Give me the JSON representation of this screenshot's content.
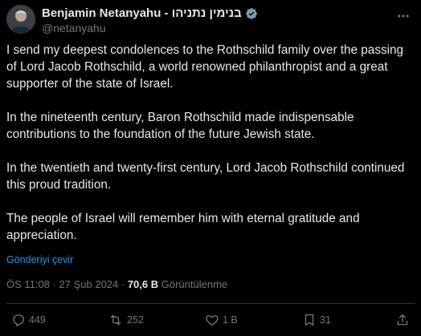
{
  "author": {
    "display_name": "Benjamin Netanyahu - בנימין נתניהו",
    "handle": "@netanyahu",
    "verified_color": "#829aab"
  },
  "tweet": {
    "paragraphs": [
      "I send my deepest condolences to the Rothschild family over the passing of Lord Jacob Rothschild, a world renowned philanthropist and a great supporter of the state of Israel.",
      "In the nineteenth century, Baron Rothschild made indispensable contributions to the foundation of the future Jewish state.",
      "In the twentieth and twenty-first century, Lord Jacob Rothschild continued this proud tradition.",
      "The people of Israel will remember him with eternal gratitude and appreciation."
    ],
    "translate_label": "Gönderiyi çevir"
  },
  "meta": {
    "time": "ÖS 11:08",
    "separator": " · ",
    "date": "27 Şub 2024",
    "views_count": "70,6 B",
    "views_label": " Görüntülenme"
  },
  "actions": {
    "replies": "449",
    "retweets": "252",
    "likes": "1 B",
    "bookmarks": "31"
  },
  "colors": {
    "background": "#000000",
    "text": "#e7e9ea",
    "muted": "#71767b",
    "link": "#1d9bf0",
    "divider": "#2f3336"
  },
  "icons": {
    "avatar": "profile-photo",
    "verified": "verified-badge-icon",
    "more": "more-horizontal-icon",
    "reply": "reply-icon",
    "retweet": "retweet-icon",
    "like": "heart-icon",
    "bookmark": "bookmark-icon",
    "share": "share-icon"
  }
}
